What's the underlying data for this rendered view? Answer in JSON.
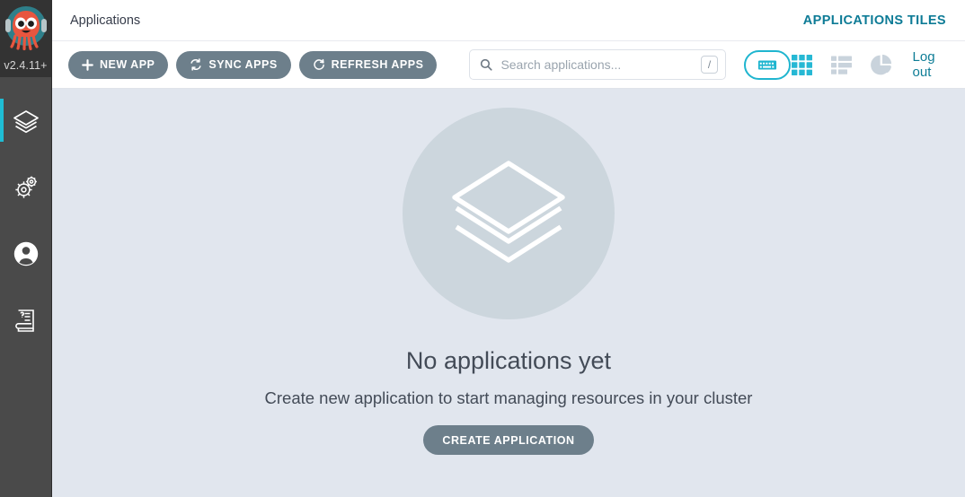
{
  "sidebar": {
    "logo_alt": "argo-octopus-logo",
    "version": "v2.4.11+",
    "items": [
      {
        "name": "applications",
        "icon": "layers-icon",
        "active": true
      },
      {
        "name": "settings",
        "icon": "gears-icon",
        "active": false
      },
      {
        "name": "user-info",
        "icon": "user-icon",
        "active": false
      },
      {
        "name": "documentation",
        "icon": "help-book-icon",
        "active": false
      }
    ],
    "active_indicator_color": "#1fbdd4"
  },
  "header": {
    "breadcrumb": "Applications",
    "page_kicker": "APPLICATIONS TILES",
    "kicker_color": "#0d7b96"
  },
  "toolbar": {
    "new_app_label": "NEW APP",
    "sync_apps_label": "SYNC APPS",
    "refresh_apps_label": "REFRESH APPS",
    "button_color": "#6d7f8b",
    "search": {
      "placeholder": "Search applications...",
      "value": "",
      "shortcut_badge": "/"
    },
    "keyboard_shortcut_button": {
      "icon": "keyboard-icon",
      "accent_color": "#1fb5cf"
    },
    "views": [
      {
        "name": "tiles-view",
        "icon": "grid-icon",
        "active": true,
        "color": "#26b8d4"
      },
      {
        "name": "list-view",
        "icon": "list-icon",
        "active": false,
        "color": "#c9d3dc"
      },
      {
        "name": "summary-view",
        "icon": "pie-chart-icon",
        "active": false,
        "color": "#c9d3dc"
      }
    ],
    "logout_label": "Log out",
    "logout_color": "#0e7d96"
  },
  "empty_state": {
    "icon": "layers-icon",
    "circle_color": "#ccd6dd",
    "title": "No applications yet",
    "subtitle": "Create new application to start managing resources in your cluster",
    "cta_label": "CREATE APPLICATION"
  }
}
